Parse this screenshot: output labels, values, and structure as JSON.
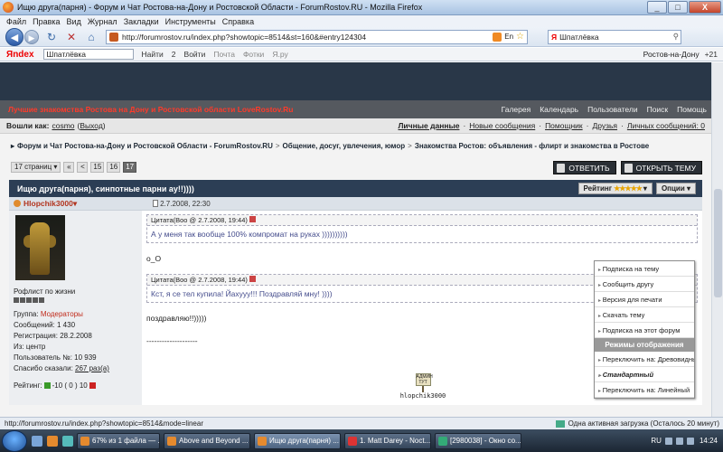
{
  "window": {
    "title": "Ищю друга(парня) - Форум и Чат Ростова-на-Дону и Ростовской Области - ForumRostov.RU - Mozilla Firefox",
    "minimize": "_",
    "maximize": "□",
    "close": "X"
  },
  "menu": [
    "Файл",
    "Правка",
    "Вид",
    "Журнал",
    "Закладки",
    "Инструменты",
    "Справка"
  ],
  "nav": {
    "url": "http://forumrostov.ru/index.php?showtopic=8514&st=160&#entry124304",
    "lang": "En",
    "search_value": "Шпатлёвка",
    "search_engine": "Я"
  },
  "yandex_bar": {
    "logo": "Яndex",
    "search_value": "Шпатлёвка",
    "find": "Найти",
    "count": "2",
    "login": "Войти",
    "mail": "Почта",
    "photos": "Фотки",
    "yaru": "Я.ру",
    "city": "Ростов-на-Дону",
    "temp": "+21"
  },
  "site": {
    "link": "Лучшие знакомства Ростова на Дону и Ростовской области LoveRostov.Ru",
    "topnav": [
      "Галерея",
      "Календарь",
      "Пользователи",
      "Поиск",
      "Помощь"
    ]
  },
  "userbar": {
    "logged_as": "Вошли как:",
    "username": "cosmo",
    "logout": "Выход",
    "links": [
      "Личные данные",
      "Новые сообщения",
      "Помощник",
      "Друзья",
      "Личных сообщений: 0"
    ]
  },
  "breadcrumb": [
    "Форум и Чат Ростова-на-Дону и Ростовской Области - ForumRostov.RU",
    "Общение, досуг, увлечения, юмор",
    "Знакомства Ростов: объявления - флирт и знакомства в Ростове"
  ],
  "pagination": {
    "pages_label": "17 страниц",
    "first": "«",
    "prev": "<",
    "pages": [
      "15",
      "16",
      "17"
    ],
    "current": "17"
  },
  "buttons": {
    "reply": "ОТВЕТИТЬ",
    "new_topic": "ОТКРЫТЬ ТЕМУ"
  },
  "topic": {
    "title": "Ищю друга(парня), синпотные парни ау!!))))",
    "rating_label": "Рейтинг",
    "rating_stars": 5,
    "options_label": "Опции"
  },
  "post": {
    "author": "Hlopchik3000",
    "date": "2.7.2008, 22:30",
    "profile": {
      "title": "Рофлист по жизни",
      "rank_dots": 5,
      "group_label": "Группа:",
      "group": "Модераторы",
      "messages": "Сообщений: 1 430",
      "registered": "Регистрация: 28.2.2008",
      "from": "Из: центр",
      "user_no": "Пользователь №: 10 939",
      "thanks_label": "Спасибо сказали:",
      "thanks_value": "267 раз(а)",
      "rating_label": "Рейтинг:",
      "rating_value": "-10 ( 0 ) 10"
    },
    "quote1": {
      "header": "Цитата(Boo @ 2.7.2008, 19:44)",
      "body": "А у меня так вообще 100% компромат на руках ))))))))))"
    },
    "text1": "о_О",
    "quote2": {
      "header": "Цитата(Boo @ 2.7.2008, 19:44)",
      "body": "Кст, я се тел купила! Йахууу!!! Поздравляй мну! ))))"
    },
    "text2": "поздравляю!!)))))",
    "separator": "--------------------",
    "sig_sign": "АДМИН ТУТ",
    "sig_name": "hlopchik3000"
  },
  "dropdown": {
    "items_top": [
      "Подписка на тему",
      "Сообщить другу",
      "Версия для печати",
      "Скачать тему",
      "Подписка на этот форум"
    ],
    "header": "Режимы отображения",
    "items_bottom": [
      "Переключить на: Древовидный",
      "Стандартный",
      "Переключить на: Линейный"
    ]
  },
  "statusbar": {
    "url": "http://forumrostov.ru/index.php?showtopic=8514&mode=linear",
    "loading": "Одна активная загрузка (Осталось 20 минут)"
  },
  "taskbar": {
    "tasks": [
      "67% из 1 файла — ...",
      "Above and Beyond ...",
      "Ищю друга(парня) ...",
      "1. Matt Darey - Noct...",
      "[2980038] - Окно со..."
    ],
    "lang": "RU",
    "time": "14:24"
  },
  "colors": {
    "site_banner": "#293748",
    "site_link": "#ff3a2a",
    "topic_bar": "#2c3e55",
    "author": "#b2341e",
    "quote_text": "#444c8c"
  }
}
